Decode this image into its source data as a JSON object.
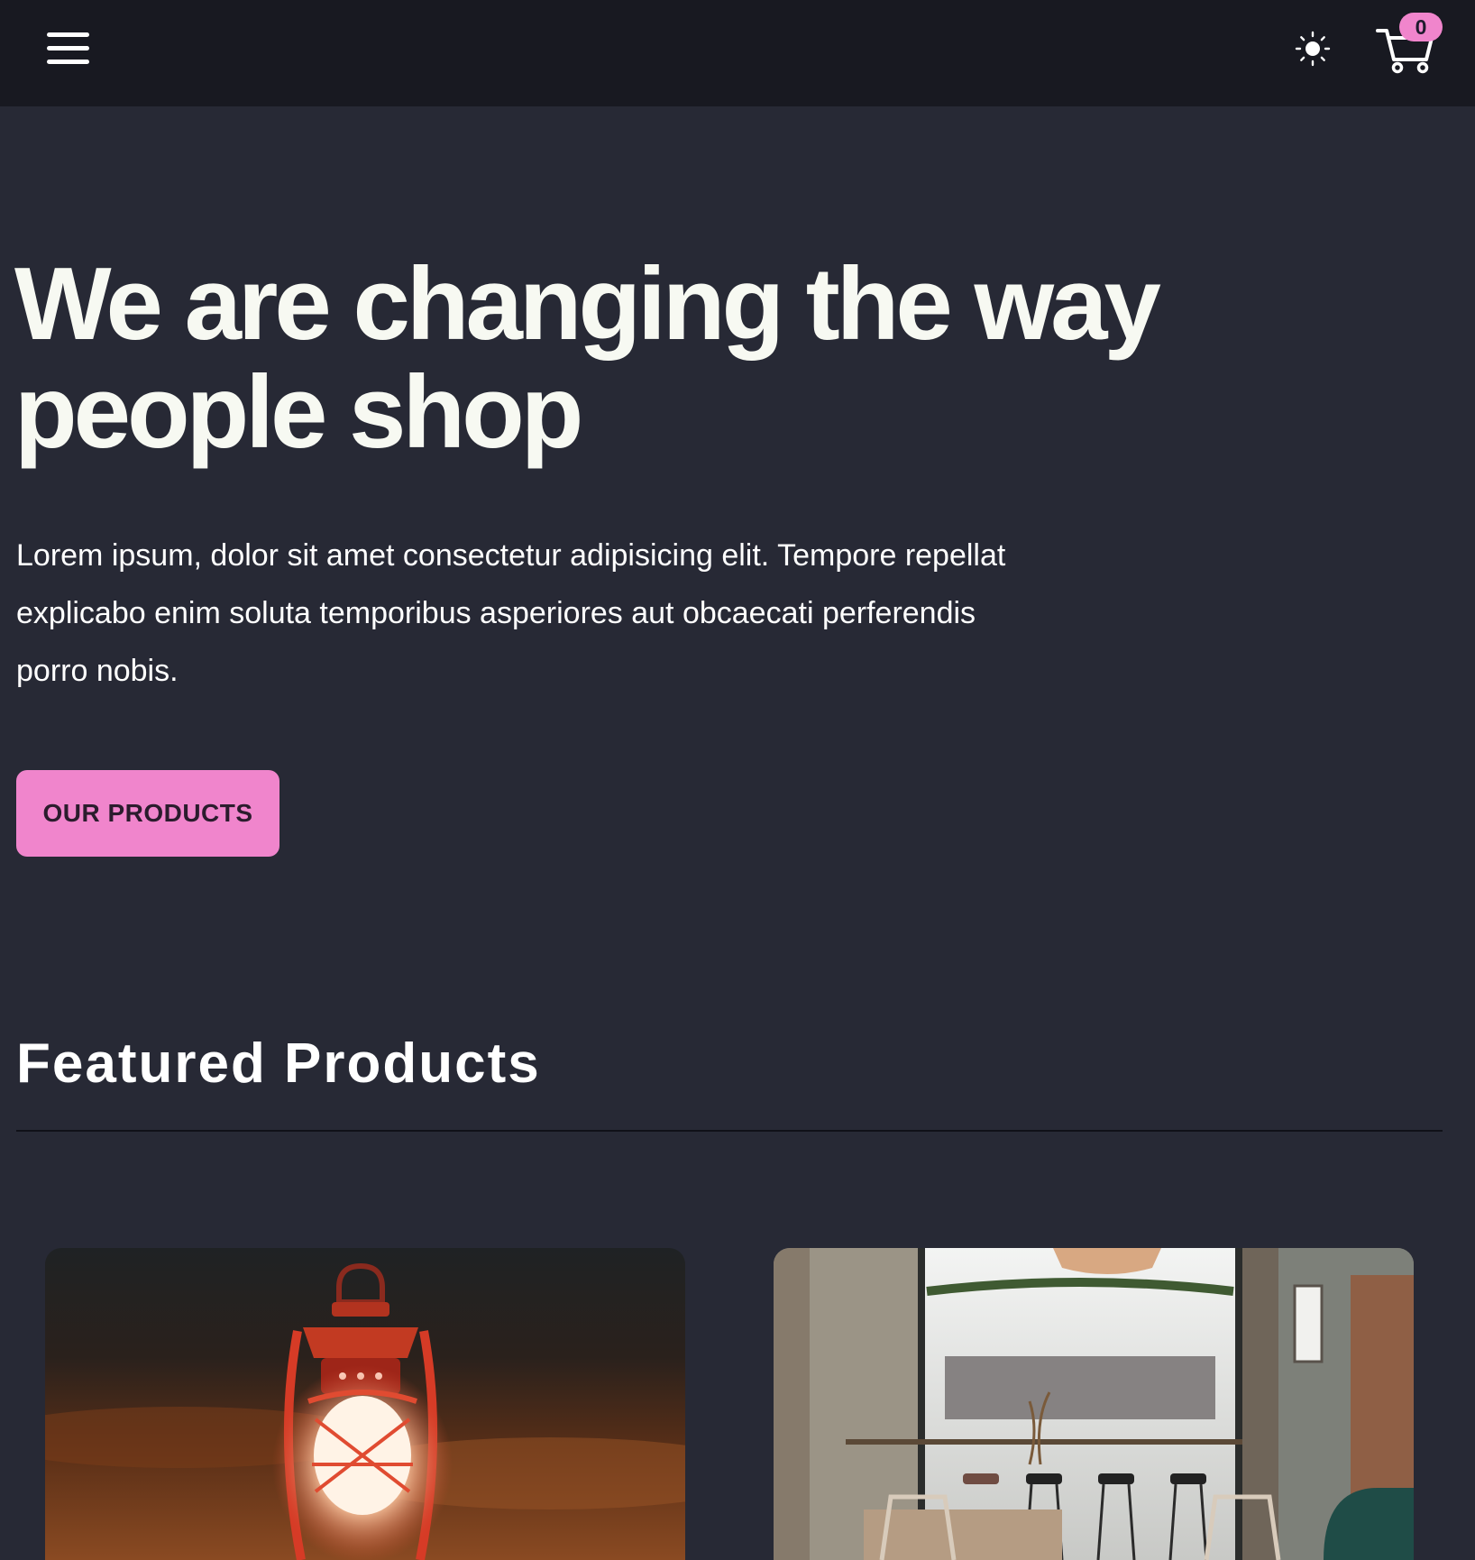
{
  "navbar": {
    "menu_icon": "hamburger-menu-icon",
    "theme_icon": "sun-icon",
    "cart_icon": "shopping-cart-icon",
    "cart_count": "0"
  },
  "hero": {
    "title_line1": "We are changing the way",
    "title_line2": "people shop",
    "description": "Lorem ipsum, dolor sit amet consectetur adipisicing elit. Tempore repellat explicabo enim soluta temporibus asperiores aut obcaecati perferendis porro nobis.",
    "cta_label": "OUR PRODUCTS"
  },
  "featured": {
    "title": "Featured Products",
    "products": [
      {
        "image": "red-lantern-image"
      },
      {
        "image": "cafe-interior-image"
      }
    ]
  },
  "colors": {
    "nav_bg": "#181921",
    "page_bg": "#272935",
    "accent": "#f085cc",
    "text": "#f7f9f2"
  }
}
